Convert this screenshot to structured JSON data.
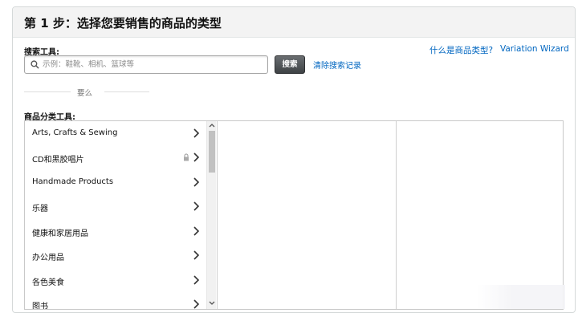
{
  "header": {
    "title": "第 1 步：选择您要销售的商品的类型"
  },
  "search": {
    "label": "搜索工具:",
    "placeholder": "示例：鞋靴、相机、篮球等",
    "button_label": "搜索",
    "clear_link": "清除搜索记录"
  },
  "links": {
    "help": "什么是商品类型?",
    "wizard": "Variation Wizard"
  },
  "divider": {
    "text": "要么"
  },
  "browse": {
    "label": "商品分类工具:",
    "categories": [
      {
        "label": "Arts, Crafts & Sewing"
      },
      {
        "label": "CD和黑胶唱片"
      },
      {
        "label": "Handmade Products"
      },
      {
        "label": "乐器"
      },
      {
        "label": "健康和家居用品"
      },
      {
        "label": "办公用品"
      },
      {
        "label": "各色美食"
      },
      {
        "label": "图书"
      }
    ]
  },
  "icons": {
    "search": "search-icon",
    "chevron": "chevron-right-icon",
    "lock": "lock-icon",
    "scroll_up": "chevron-up-icon",
    "scroll_down": "chevron-down-icon"
  },
  "colors": {
    "link": "#0066c0",
    "header_bg": "#f3f3f3",
    "button_bg": "#4f5356"
  }
}
